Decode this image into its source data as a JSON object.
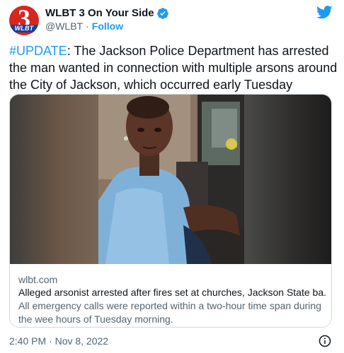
{
  "account": {
    "avatar_number": "3",
    "avatar_logo_text": "WLBT",
    "display_name": "WLBT 3 On Your Side",
    "handle": "@WLBT",
    "separator": "·",
    "follow_label": "Follow"
  },
  "tweet": {
    "hashtag": "#UPDATE",
    "text": ": The Jackson Police Department has arrested the man wanted in connection with multiple arsons around the City of Jackson, which occurred early Tuesday morning."
  },
  "card": {
    "domain": "wlbt.com",
    "title": "Alleged arsonist arrested after fires set at churches, Jackson State ba...",
    "description": "All emergency calls were reported within a two-hour time span during the wee hours of Tuesday morning."
  },
  "footer": {
    "timestamp": "2:40 PM · Nov 8, 2022"
  },
  "icons": {
    "verified": "verified-badge-icon",
    "brand": "twitter-bird-icon",
    "info": "info-icon"
  },
  "colors": {
    "accent": "#1d9bf0",
    "secondary_text": "#536471",
    "avatar_red": "#d7261e",
    "avatar_blue": "#1a3f9c"
  }
}
